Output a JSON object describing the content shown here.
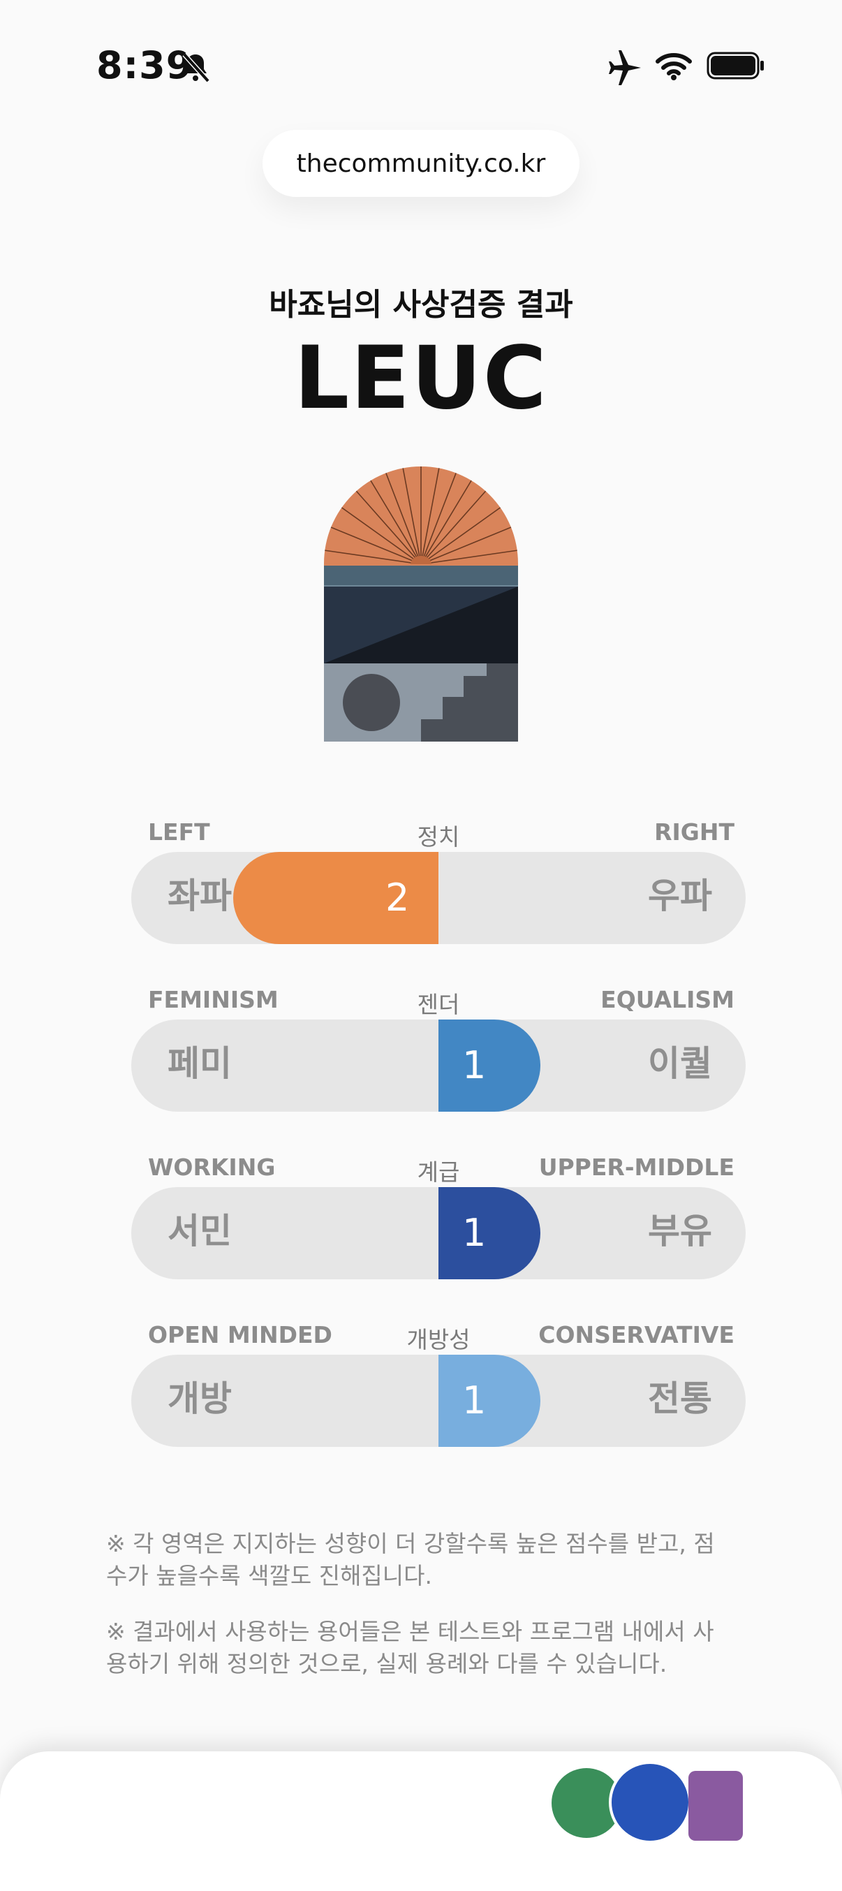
{
  "status_bar": {
    "time": "8:39"
  },
  "browser": {
    "url": "thecommunity.co.kr"
  },
  "result": {
    "subtitle": "바죠님의 사상검증 결과",
    "code": "LEUC"
  },
  "scales": [
    {
      "category": "정치",
      "left_en": "LEFT",
      "right_en": "RIGHT",
      "left_ko": "좌파",
      "right_ko": "우파",
      "score": "2",
      "direction": "left",
      "color": "#ec8b47"
    },
    {
      "category": "젠더",
      "left_en": "FEMINISM",
      "right_en": "EQUALISM",
      "left_ko": "페미",
      "right_ko": "이퀄",
      "score": "1",
      "direction": "right",
      "color": "#4287c4"
    },
    {
      "category": "계급",
      "left_en": "WORKING",
      "right_en": "UPPER-MIDDLE",
      "left_ko": "서민",
      "right_ko": "부유",
      "score": "1",
      "direction": "right",
      "color": "#2c4f9e"
    },
    {
      "category": "개방성",
      "left_en": "OPEN MINDED",
      "right_en": "CONSERVATIVE",
      "left_ko": "개방",
      "right_ko": "전통",
      "score": "1",
      "direction": "right",
      "color": "#78aede"
    }
  ],
  "notes": [
    "※ 각 영역은 지지하는 성향이 더 강할수록 높은 점수를 받고, 점수가 높을수록 색깔도 진해집니다.",
    "※ 결과에서 사용하는 용어들은 본 테스트와 프로그램 내에서 사용하기 위해 정의한 것으로, 실제 용례와 다를 수 있습니다."
  ],
  "icons": [
    "bell-slash-icon",
    "airplane-icon",
    "wifi-icon",
    "battery-icon"
  ]
}
